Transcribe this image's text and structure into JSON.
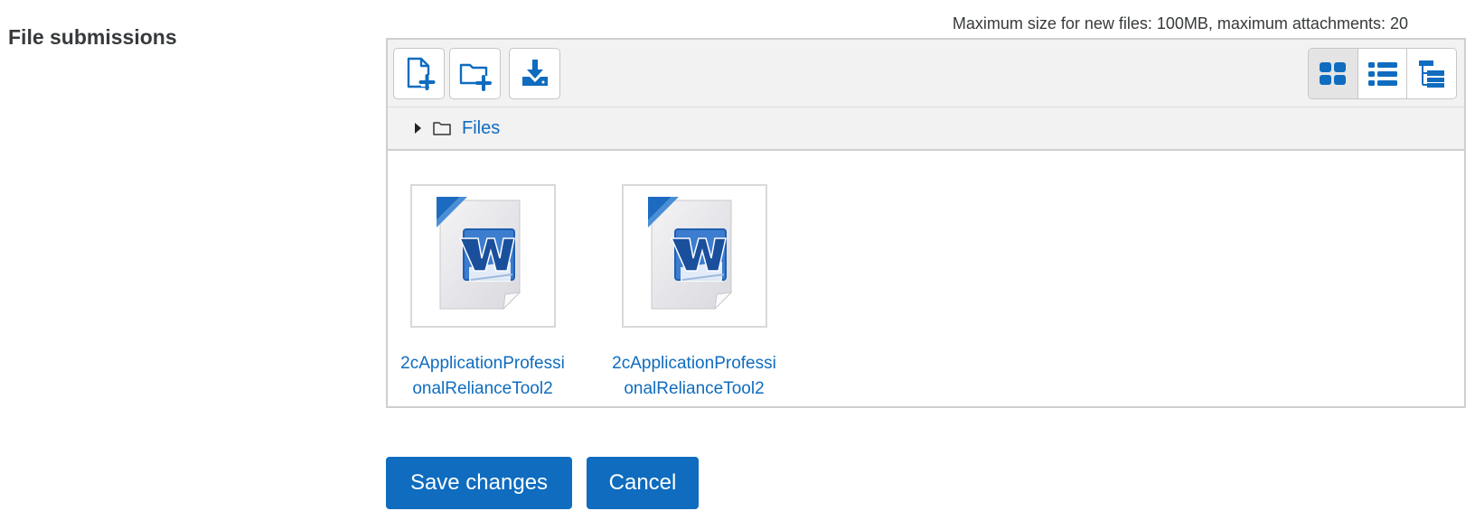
{
  "form": {
    "section_label": "File submissions",
    "limits_text": "Maximum size for new files: 100MB, maximum attachments: 20"
  },
  "toolbar": {
    "buttons": [
      {
        "name": "add-file-button",
        "icon": "file-plus-icon"
      },
      {
        "name": "create-folder-button",
        "icon": "folder-plus-icon"
      },
      {
        "name": "download-all-button",
        "icon": "download-icon"
      }
    ],
    "views": [
      {
        "name": "view-icons-button",
        "icon": "grid-icon",
        "active": true
      },
      {
        "name": "view-details-button",
        "icon": "list-icon",
        "active": false
      },
      {
        "name": "view-tree-button",
        "icon": "tree-icon",
        "active": false
      }
    ]
  },
  "path": {
    "folder_label": "Files"
  },
  "files": [
    {
      "name": "2cApplicationProfessionalRelianceTool2",
      "icon": "word-document-icon"
    },
    {
      "name": "2cApplicationProfessionalRelianceTool2",
      "icon": "word-document-icon"
    }
  ],
  "actions": {
    "save_label": "Save changes",
    "cancel_label": "Cancel"
  },
  "colors": {
    "accent": "#0f6cbf",
    "word_blue": "#1b5fb4"
  }
}
